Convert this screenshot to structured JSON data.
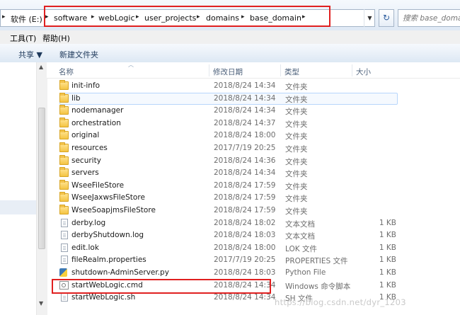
{
  "address": {
    "drive": "软件 (E:)",
    "crumbs": [
      "software",
      "webLogic",
      "user_projects",
      "domains",
      "base_domain"
    ]
  },
  "search": {
    "placeholder": "搜索 base_domain"
  },
  "menu": {
    "tools": "工具(T)",
    "help": "帮助(H)"
  },
  "toolbar": {
    "share": "共享 ▼",
    "new_folder": "新建文件夹"
  },
  "columns": {
    "name": "名称",
    "date": "修改日期",
    "type": "类型",
    "size": "大小"
  },
  "files": [
    {
      "name": "init-info",
      "date": "2018/8/24 14:34",
      "type": "文件夹",
      "size": "",
      "icon": "folder"
    },
    {
      "name": "lib",
      "date": "2018/8/24 14:34",
      "type": "文件夹",
      "size": "",
      "icon": "folder"
    },
    {
      "name": "nodemanager",
      "date": "2018/8/24 14:34",
      "type": "文件夹",
      "size": "",
      "icon": "folder"
    },
    {
      "name": "orchestration",
      "date": "2018/8/24 14:37",
      "type": "文件夹",
      "size": "",
      "icon": "folder"
    },
    {
      "name": "original",
      "date": "2018/8/24 18:00",
      "type": "文件夹",
      "size": "",
      "icon": "folder"
    },
    {
      "name": "resources",
      "date": "2017/7/19 20:25",
      "type": "文件夹",
      "size": "",
      "icon": "folder"
    },
    {
      "name": "security",
      "date": "2018/8/24 14:36",
      "type": "文件夹",
      "size": "",
      "icon": "folder"
    },
    {
      "name": "servers",
      "date": "2018/8/24 14:34",
      "type": "文件夹",
      "size": "",
      "icon": "folder"
    },
    {
      "name": "WseeFileStore",
      "date": "2018/8/24 17:59",
      "type": "文件夹",
      "size": "",
      "icon": "folder"
    },
    {
      "name": "WseeJaxwsFileStore",
      "date": "2018/8/24 17:59",
      "type": "文件夹",
      "size": "",
      "icon": "folder"
    },
    {
      "name": "WseeSoapjmsFileStore",
      "date": "2018/8/24 17:59",
      "type": "文件夹",
      "size": "",
      "icon": "folder"
    },
    {
      "name": "derby.log",
      "date": "2018/8/24 18:02",
      "type": "文本文档",
      "size": "1 KB",
      "icon": "file"
    },
    {
      "name": "derbyShutdown.log",
      "date": "2018/8/24 18:03",
      "type": "文本文档",
      "size": "1 KB",
      "icon": "file"
    },
    {
      "name": "edit.lok",
      "date": "2018/8/24 18:00",
      "type": "LOK 文件",
      "size": "1 KB",
      "icon": "file"
    },
    {
      "name": "fileRealm.properties",
      "date": "2017/7/19 20:25",
      "type": "PROPERTIES 文件",
      "size": "1 KB",
      "icon": "file"
    },
    {
      "name": "shutdown-AdminServer.py",
      "date": "2018/8/24 18:03",
      "type": "Python File",
      "size": "1 KB",
      "icon": "python"
    },
    {
      "name": "startWebLogic.cmd",
      "date": "2018/8/24 14:34",
      "type": "Windows 命令脚本",
      "size": "1 KB",
      "icon": "cmd"
    },
    {
      "name": "startWebLogic.sh",
      "date": "2018/8/24 14:34",
      "type": "SH 文件",
      "size": "1 KB",
      "icon": "file"
    }
  ],
  "watermark": "https://blog.csdn.net/dyr_1203"
}
